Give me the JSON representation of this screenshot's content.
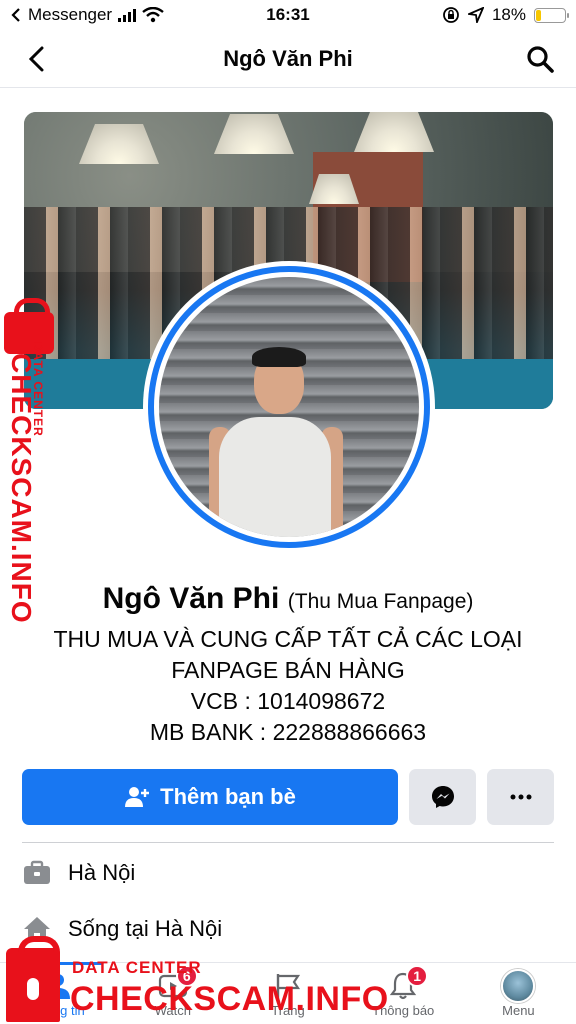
{
  "status_bar": {
    "carrier": "Messenger",
    "time": "16:31",
    "battery_percent": "18%",
    "battery_level": 0.18
  },
  "nav": {
    "title": "Ngô Văn Phi"
  },
  "profile": {
    "name": "Ngô Văn Phi",
    "alternate_name": "(Thu Mua Fanpage)",
    "bio_lines": [
      "THU MUA VÀ CUNG CẤP TẤT CẢ CÁC LOẠI",
      "FANPAGE BÁN HÀNG",
      "VCB : 1014098672",
      "MB BANK : 222888866663"
    ]
  },
  "actions": {
    "add_friend_label": "Thêm bạn bè"
  },
  "details": [
    {
      "icon": "briefcase-icon",
      "text": "Hà Nội"
    },
    {
      "icon": "home-icon",
      "text": "Sống tại Hà Nội"
    }
  ],
  "tab_bar": {
    "tabs": [
      {
        "label": "Thông tin",
        "icon": "profile-icon",
        "active": true
      },
      {
        "label": "Watch",
        "icon": "watch-icon",
        "badge": "6"
      },
      {
        "label": "Trang",
        "icon": "flag-icon"
      },
      {
        "label": "Thông báo",
        "icon": "bell-icon",
        "badge": "1"
      },
      {
        "label": "Menu",
        "icon": "menu-avatar"
      }
    ]
  },
  "watermark": {
    "vertical_sub": "DATA CENTER",
    "vertical_main": "CHECKSCAM.INFO",
    "bottom_sub": "DATA CENTER",
    "bottom_main": "CHECKSCAM.INFO"
  },
  "colors": {
    "accent": "#1877f2",
    "badge": "#e41e3f",
    "watermark": "#e8111b",
    "battery": "#f7c700"
  }
}
